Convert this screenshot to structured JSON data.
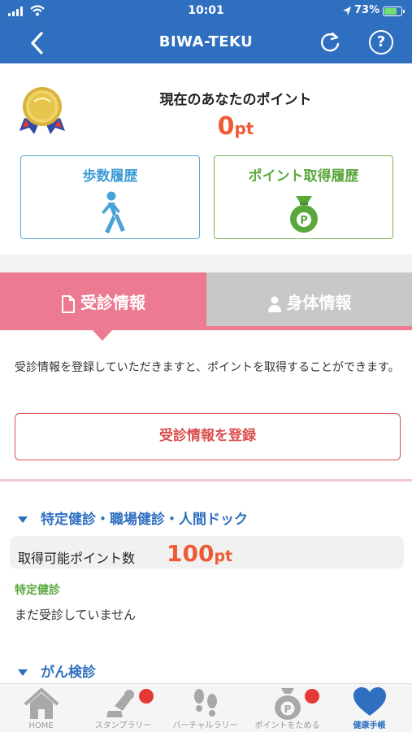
{
  "status": {
    "time": "10:01",
    "battery": "73%"
  },
  "nav": {
    "title": "BIWA-TEKU"
  },
  "points": {
    "label": "現在のあなたのポイント",
    "value": "0",
    "unit": "pt"
  },
  "history": {
    "steps_label": "歩数履歴",
    "point_label": "ポイント取得履歴"
  },
  "tabs": {
    "exam": "受診情報",
    "body": "身体情報"
  },
  "exam": {
    "description": "受診情報を登録していただきますと、ポイントを取得することができます。",
    "register_button": "受診情報を登録",
    "section1": {
      "title": "特定健診・職場健診・人間ドック",
      "points_label": "取得可能ポイント数",
      "points_value": "100",
      "points_unit": "pt",
      "subhead": "特定健診",
      "status": "まだ受診していません"
    },
    "section2": {
      "title": "がん検診"
    }
  },
  "tabbar": {
    "items": [
      {
        "label": "HOME",
        "icon": "home-icon"
      },
      {
        "label": "スタンプラリー",
        "icon": "stamp-icon"
      },
      {
        "label": "バーチャルラリー",
        "icon": "footprints-icon"
      },
      {
        "label": "ポイントをためる",
        "icon": "point-bag-icon"
      },
      {
        "label": "健康手帳",
        "icon": "heart-icon"
      }
    ]
  },
  "colors": {
    "primary": "#2f6fc0",
    "pink": "#ec7a90",
    "orange": "#ef5a36",
    "green": "#5aa83c",
    "red": "#d9504e"
  }
}
